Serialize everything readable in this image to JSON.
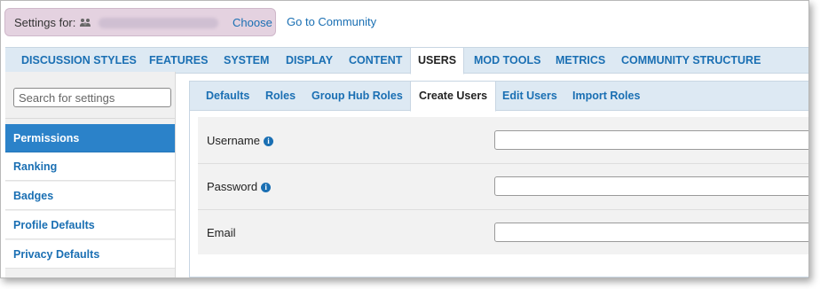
{
  "settings_bar": {
    "label": "Settings for:",
    "choose_label": "Choose",
    "community_link": "Go to Community"
  },
  "main_tabs": [
    {
      "label": "DISCUSSION STYLES",
      "active": false
    },
    {
      "label": "FEATURES",
      "active": false
    },
    {
      "label": "SYSTEM",
      "active": false
    },
    {
      "label": "DISPLAY",
      "active": false
    },
    {
      "label": "CONTENT",
      "active": false
    },
    {
      "label": "USERS",
      "active": true
    },
    {
      "label": "MOD TOOLS",
      "active": false
    },
    {
      "label": "METRICS",
      "active": false
    },
    {
      "label": "COMMUNITY STRUCTURE",
      "active": false
    }
  ],
  "sidebar": {
    "search_placeholder": "Search for settings",
    "items": [
      {
        "label": "Permissions",
        "active": true
      },
      {
        "label": "Ranking",
        "active": false
      },
      {
        "label": "Badges",
        "active": false
      },
      {
        "label": "Profile Defaults",
        "active": false
      },
      {
        "label": "Privacy Defaults",
        "active": false
      }
    ]
  },
  "sub_tabs": [
    {
      "label": "Defaults",
      "active": false
    },
    {
      "label": "Roles",
      "active": false
    },
    {
      "label": "Group Hub Roles",
      "active": false
    },
    {
      "label": "Create Users",
      "active": true
    },
    {
      "label": "Edit Users",
      "active": false
    },
    {
      "label": "Import Roles",
      "active": false
    }
  ],
  "form": {
    "fields": [
      {
        "label": "Username",
        "info": true,
        "value": ""
      },
      {
        "label": "Password",
        "info": true,
        "value": ""
      },
      {
        "label": "Email",
        "info": false,
        "value": ""
      }
    ]
  },
  "colors": {
    "link": "#1a6fb3",
    "active_sidebar": "#2b82c9",
    "tab_bar": "#dde9f3",
    "settings_pill": "#e4d2e0"
  }
}
